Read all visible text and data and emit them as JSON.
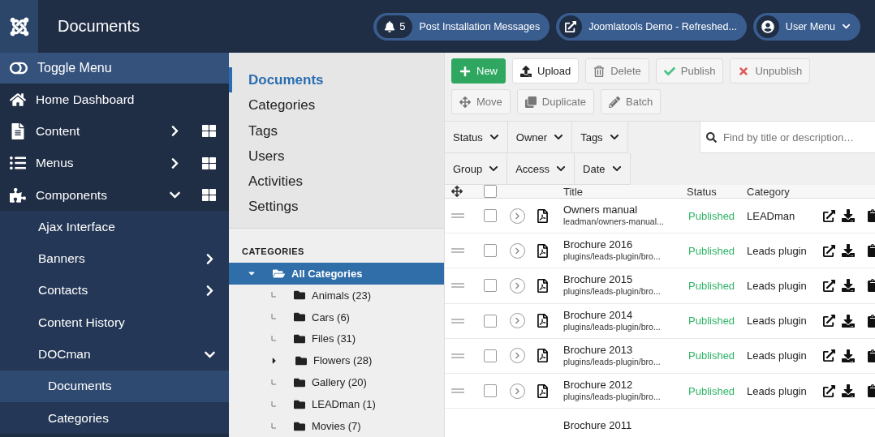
{
  "header": {
    "title": "Documents",
    "notifications": {
      "count": "5",
      "label": "Post Installation Messages"
    },
    "site": {
      "label": "Joomlatools Demo - Refreshed..."
    },
    "user": {
      "label": "User Menu"
    }
  },
  "sidebar": {
    "toggle": "Toggle Menu",
    "items": [
      {
        "label": "Home Dashboard",
        "kind": "link",
        "selected": false
      },
      {
        "label": "Content",
        "kind": "group",
        "expanded": false,
        "selected": false
      },
      {
        "label": "Menus",
        "kind": "group",
        "expanded": false,
        "selected": false
      },
      {
        "label": "Components",
        "kind": "group",
        "expanded": true,
        "selected": false,
        "children": [
          {
            "label": "Ajax Interface",
            "kind": "link",
            "selected": false
          },
          {
            "label": "Banners",
            "kind": "group",
            "expanded": false,
            "selected": false
          },
          {
            "label": "Contacts",
            "kind": "group",
            "expanded": false,
            "selected": false
          },
          {
            "label": "Content History",
            "kind": "link",
            "selected": false
          },
          {
            "label": "DOCman",
            "kind": "group",
            "expanded": true,
            "selected": false,
            "children": [
              {
                "label": "Documents",
                "kind": "link",
                "selected": true
              },
              {
                "label": "Categories",
                "kind": "link",
                "selected": false
              }
            ]
          }
        ]
      }
    ]
  },
  "subnav": {
    "items": [
      {
        "label": "Documents",
        "selected": true
      },
      {
        "label": "Categories",
        "selected": false
      },
      {
        "label": "Tags",
        "selected": false
      },
      {
        "label": "Users",
        "selected": false
      },
      {
        "label": "Activities",
        "selected": false
      },
      {
        "label": "Settings",
        "selected": false
      }
    ]
  },
  "categories": {
    "heading": "CATEGORIES",
    "tree": [
      {
        "label": "All Categories",
        "kind": "branch",
        "expanded": true,
        "selected": true,
        "children": [
          {
            "label": "Animals (23)",
            "kind": "leaf",
            "selected": false
          },
          {
            "label": "Cars (6)",
            "kind": "leaf",
            "selected": false
          },
          {
            "label": "Files (31)",
            "kind": "leaf",
            "selected": false
          },
          {
            "label": "Flowers (28)",
            "kind": "branch",
            "expanded": false,
            "selected": false
          },
          {
            "label": "Gallery (20)",
            "kind": "leaf",
            "selected": false
          },
          {
            "label": "LEADman (1)",
            "kind": "leaf",
            "selected": false
          },
          {
            "label": "Movies (7)",
            "kind": "leaf",
            "selected": false
          }
        ]
      }
    ]
  },
  "toolbar": [
    {
      "label": "New",
      "kind": "new",
      "disabled": false
    },
    {
      "label": "Upload",
      "kind": "upload",
      "disabled": false
    },
    {
      "label": "Delete",
      "kind": "delete",
      "disabled": true
    },
    {
      "label": "Publish",
      "kind": "publish",
      "disabled": true
    },
    {
      "label": "Unpublish",
      "kind": "unpublish",
      "disabled": true
    },
    {
      "label": "Move",
      "kind": "move",
      "disabled": true
    },
    {
      "label": "Duplicate",
      "kind": "duplicate",
      "disabled": true
    },
    {
      "label": "Batch",
      "kind": "batch",
      "disabled": true
    }
  ],
  "filters": [
    [
      "Status",
      "Owner",
      "Tags"
    ],
    [
      "Group",
      "Access",
      "Date"
    ]
  ],
  "search": {
    "placeholder": "Find by title or description…"
  },
  "table": {
    "columns": [
      "Title",
      "Status",
      "Category"
    ],
    "select_all": {
      "checked": false
    },
    "rows": [
      {
        "title": "Owners manual",
        "path": "leadman/owners-manual...",
        "status": "Published",
        "category": "LEADman",
        "checked": false
      },
      {
        "title": "Brochure 2016",
        "path": "plugins/leads-plugin/bro...",
        "status": "Published",
        "category": "Leads plugin",
        "checked": false
      },
      {
        "title": "Brochure 2015",
        "path": "plugins/leads-plugin/bro...",
        "status": "Published",
        "category": "Leads plugin",
        "checked": false
      },
      {
        "title": "Brochure 2014",
        "path": "plugins/leads-plugin/bro...",
        "status": "Published",
        "category": "Leads plugin",
        "checked": false
      },
      {
        "title": "Brochure 2013",
        "path": "plugins/leads-plugin/bro...",
        "status": "Published",
        "category": "Leads plugin",
        "checked": false
      },
      {
        "title": "Brochure 2012",
        "path": "plugins/leads-plugin/bro...",
        "status": "Published",
        "category": "Leads plugin",
        "checked": false
      },
      {
        "title": "Brochure 2011",
        "kind": "partial"
      }
    ]
  }
}
